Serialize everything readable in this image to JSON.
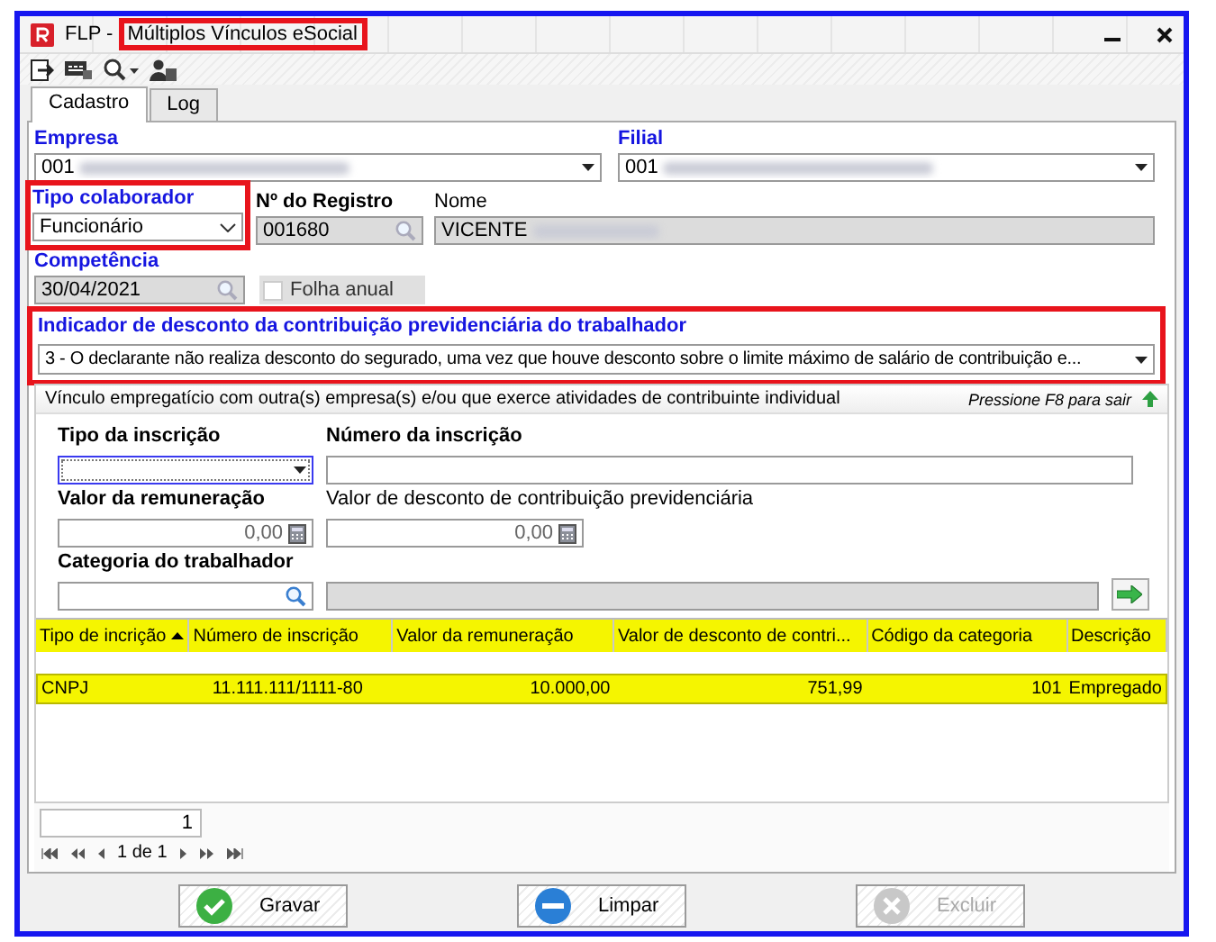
{
  "window": {
    "app": "FLP -",
    "title": "Múltiplos Vínculos eSocial",
    "annotated": true
  },
  "tabs": [
    {
      "label": "Cadastro",
      "selected": true
    },
    {
      "label": "Log",
      "selected": false
    }
  ],
  "empresa": {
    "label": "Empresa",
    "required": true,
    "bold": true,
    "value": "001"
  },
  "filial": {
    "label": "Filial",
    "required": true,
    "bold": true,
    "value": "001"
  },
  "tipo_colaborador": {
    "label": "Tipo colaborador",
    "required": true,
    "bold": true,
    "value": "Funcionário",
    "annotated": true
  },
  "registro": {
    "label": "Nº do Registro",
    "required": false,
    "bold": true,
    "value": "001680",
    "disabled": true
  },
  "nome": {
    "label": "Nome",
    "required": false,
    "bold": false,
    "value": "VICENTE",
    "disabled": true
  },
  "competencia": {
    "label": "Competência",
    "required": true,
    "bold": true,
    "value": "30/04/2021",
    "disabled": true
  },
  "folha_anual": {
    "label": "Folha anual",
    "checked": false,
    "disabled": true
  },
  "indicador": {
    "label": "Indicador de desconto da contribuição previdenciária do trabalhador",
    "required": true,
    "bold": true,
    "value": "3 - O declarante não realiza desconto do segurado, uma vez que houve desconto sobre o limite máximo de salário de contribuição e...",
    "annotated": true
  },
  "vinculo": {
    "title": "Vínculo empregatício com outra(s) empresa(s) e/ou que exerce atividades de contribuinte individual",
    "hint": "Pressione F8 para sair",
    "tipo_inscricao": {
      "label": "Tipo da inscrição",
      "required": false,
      "bold": true
    },
    "numero_inscricao": {
      "label": "Número da inscrição",
      "required": false,
      "bold": true
    },
    "valor_remuneracao": {
      "label": "Valor da remuneração",
      "required": false,
      "bold": true,
      "value": "0,00"
    },
    "valor_desconto": {
      "label": "Valor de desconto de contribuição previdenciária",
      "required": false,
      "bold": false,
      "value": "0,00"
    },
    "categoria": {
      "label": "Categoria do trabalhador",
      "required": false,
      "bold": true
    }
  },
  "table": {
    "highlighted": true,
    "columns": [
      {
        "label": "Tipo de incrição",
        "sorted": true
      },
      {
        "label": "Número de inscrição",
        "sorted": false
      },
      {
        "label": "Valor da remuneração",
        "sorted": false
      },
      {
        "label": "Valor de desconto de contri...",
        "sorted": false
      },
      {
        "label": "Código da categoria",
        "sorted": false
      },
      {
        "label": "Descrição",
        "sorted": false
      }
    ],
    "rows": [
      {
        "cells": [
          "CNPJ",
          "11.111.111/1111-80",
          "10.000,00",
          "751,99",
          "101",
          "Empregado"
        ],
        "highlighted": true
      }
    ]
  },
  "pager": {
    "count": "1",
    "page": "1 de 1"
  },
  "buttons": [
    {
      "label": "Gravar",
      "kind": "save",
      "disabled": false
    },
    {
      "label": "Limpar",
      "kind": "clear",
      "disabled": false
    },
    {
      "label": "Excluir",
      "kind": "delete",
      "disabled": true
    }
  ]
}
